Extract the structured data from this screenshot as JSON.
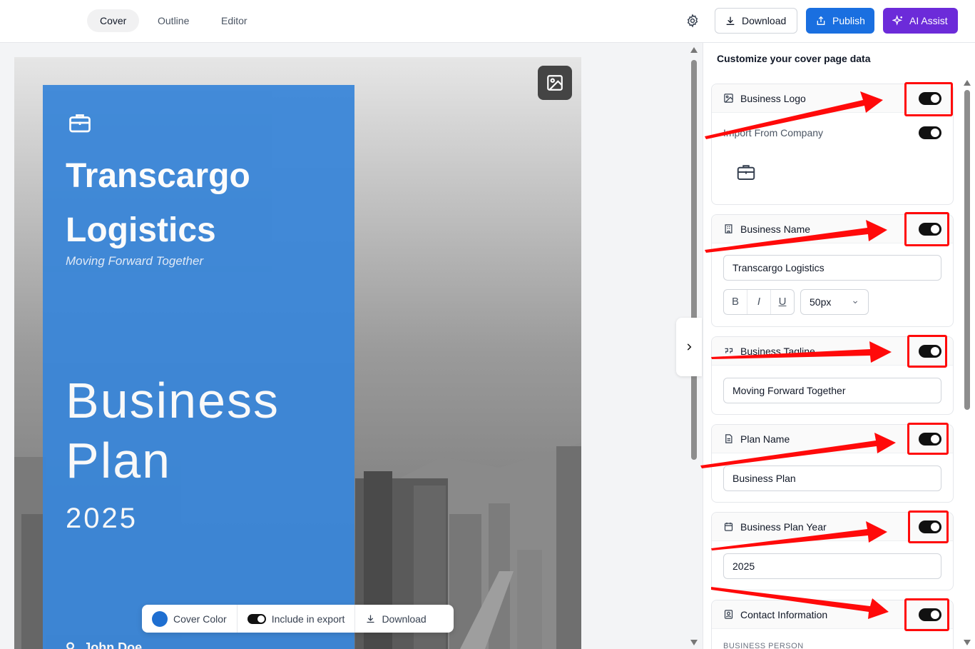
{
  "topbar": {
    "tabs": [
      {
        "label": "Cover",
        "active": true
      },
      {
        "label": "Outline",
        "active": false
      },
      {
        "label": "Editor",
        "active": false
      }
    ],
    "download_label": "Download",
    "publish_label": "Publish",
    "ai_label": "AI Assist",
    "publish_color": "#1a6fe0",
    "ai_color": "#6c2bd9"
  },
  "cover": {
    "brand": "Transcargo Logistics",
    "tagline": "Moving Forward Together",
    "plan_title": "Business Plan",
    "year": "2025",
    "person": "John Doe",
    "color_accent": "#3a86d8"
  },
  "floatbar": {
    "cover_color_label": "Cover Color",
    "include_label": "Include in export",
    "download_label": "Download"
  },
  "panel": {
    "title": "Customize your cover page data",
    "logo": {
      "label": "Business Logo",
      "import_label": "Import From Company"
    },
    "name": {
      "label": "Business Name",
      "value": "Transcargo Logistics",
      "font_size": "50px"
    },
    "tagline": {
      "label": "Business Tagline",
      "value": "Moving Forward Together"
    },
    "plan": {
      "label": "Plan Name",
      "value": "Business Plan"
    },
    "year": {
      "label": "Business Plan Year",
      "value": "2025"
    },
    "contact": {
      "label": "Contact Information",
      "section": "BUSINESS PERSON"
    }
  }
}
